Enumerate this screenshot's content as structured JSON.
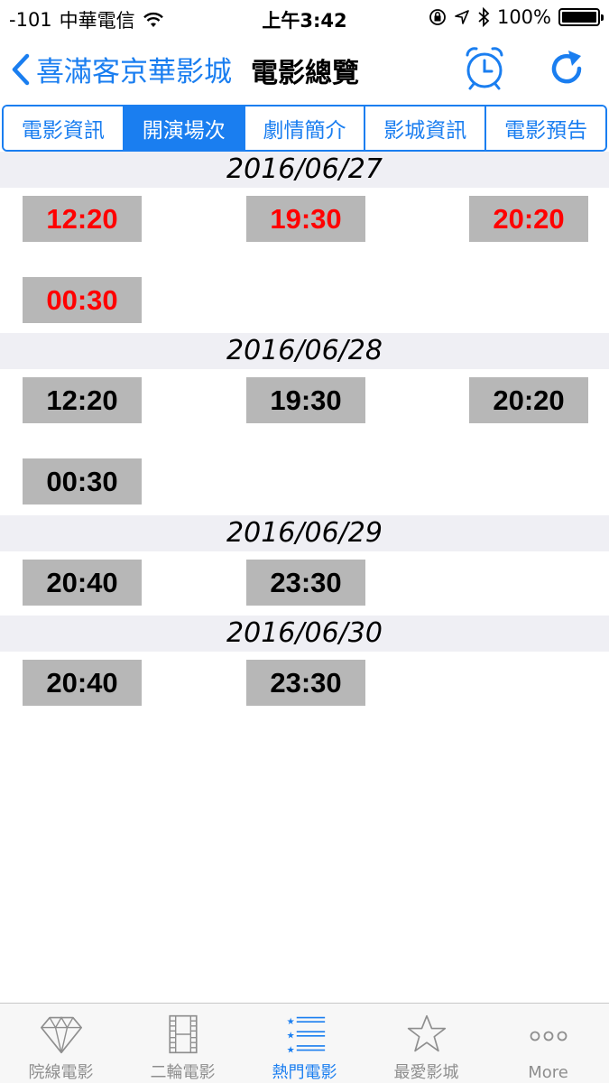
{
  "status_bar": {
    "signal": "-101",
    "carrier": "中華電信",
    "time": "上午3:42",
    "battery_percent": "100%"
  },
  "nav": {
    "back_label": "喜滿客京華影城",
    "title": "電影總覽"
  },
  "segments": [
    {
      "label": "電影資訊",
      "active": false
    },
    {
      "label": "開演場次",
      "active": true
    },
    {
      "label": "劇情簡介",
      "active": false
    },
    {
      "label": "影城資訊",
      "active": false
    },
    {
      "label": "電影預告",
      "active": false
    }
  ],
  "schedule": [
    {
      "date": "2016/06/27",
      "times": [
        {
          "time": "12:20",
          "color": "#ff0000"
        },
        {
          "time": "19:30",
          "color": "#ff0000"
        },
        {
          "time": "20:20",
          "color": "#ff0000"
        },
        {
          "time": "00:30",
          "color": "#ff0000"
        }
      ]
    },
    {
      "date": "2016/06/28",
      "times": [
        {
          "time": "12:20",
          "color": "#000000"
        },
        {
          "time": "19:30",
          "color": "#000000"
        },
        {
          "time": "20:20",
          "color": "#000000"
        },
        {
          "time": "00:30",
          "color": "#000000"
        }
      ]
    },
    {
      "date": "2016/06/29",
      "times": [
        {
          "time": "20:40",
          "color": "#000000"
        },
        {
          "time": "23:30",
          "color": "#000000"
        }
      ]
    },
    {
      "date": "2016/06/30",
      "times": [
        {
          "time": "20:40",
          "color": "#000000"
        },
        {
          "time": "23:30",
          "color": "#000000"
        }
      ]
    }
  ],
  "tabs": [
    {
      "label": "院線電影",
      "icon": "diamond-icon",
      "active": false
    },
    {
      "label": "二輪電影",
      "icon": "film-strip-icon",
      "active": false
    },
    {
      "label": "熱門電影",
      "icon": "star-list-icon",
      "active": true
    },
    {
      "label": "最愛影城",
      "icon": "star-icon",
      "active": false
    },
    {
      "label": "More",
      "icon": "more-dots-icon",
      "active": false
    }
  ],
  "colors": {
    "accent": "#1a7ef0",
    "chip_background": "#b7b7b7",
    "date_header_background": "#efeff4"
  }
}
